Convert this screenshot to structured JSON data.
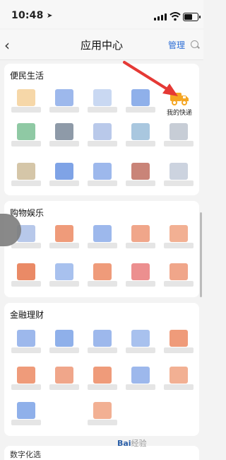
{
  "status_bar": {
    "time": "10:48"
  },
  "nav": {
    "back_icon": "chevron-left-icon",
    "title": "应用中心",
    "manage": "管理",
    "search_icon": "search-icon"
  },
  "sections": [
    {
      "title": "便民生活"
    },
    {
      "title": "购物娱乐"
    },
    {
      "title": "金融理财"
    }
  ],
  "highlight_app": {
    "label": "我的快递",
    "icon": "delivery-truck-icon",
    "color": "#f5a623"
  },
  "annotation": {
    "arrow_color": "#e53935"
  },
  "watermark": {
    "brand": "Bai",
    "suffix": "经验"
  },
  "next_section_partial": "数字化选",
  "colors": {
    "accent": "#2f6fd6",
    "blur_blue": "#9db8ec",
    "blur_orange": "#ef9b7a",
    "blur_grey": "#cfd3da"
  }
}
